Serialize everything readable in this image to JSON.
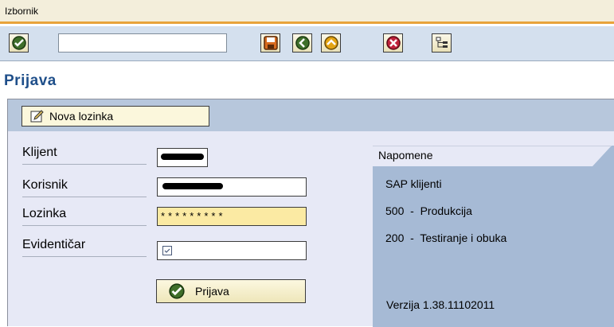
{
  "menubar": {
    "label": "Izbornik"
  },
  "toolbar": {
    "command_field_value": "",
    "buttons": [
      {
        "name": "enter",
        "icon": "checkmark-icon"
      },
      {
        "name": "save",
        "icon": "save-icon"
      },
      {
        "name": "back",
        "icon": "back-icon"
      },
      {
        "name": "exit",
        "icon": "exit-icon"
      },
      {
        "name": "cancel",
        "icon": "cancel-icon"
      },
      {
        "name": "hierarchy",
        "icon": "tree-icon"
      }
    ]
  },
  "page": {
    "title": "Prijava"
  },
  "panel": {
    "new_password_button": "Nova lozinka",
    "fields": {
      "client_label": "Klijent",
      "user_label": "Korisnik",
      "password_label": "Lozinka",
      "password_value": "*********",
      "evidenticar_label": "Evidentičar"
    },
    "login_button": "Prijava"
  },
  "notes": {
    "title": "Napomene",
    "lines": [
      "SAP klijenti",
      "500  -  Produkcija",
      "200  -  Testiranje i obuka"
    ],
    "version": "Verzija 1.38.11102011"
  },
  "colors": {
    "accent_orange": "#e8a33a",
    "title_blue": "#1f4f8a",
    "panel_bg": "#e7e9f6",
    "notes_bg": "#a6bad5",
    "active_input": "#fbeaa3"
  }
}
